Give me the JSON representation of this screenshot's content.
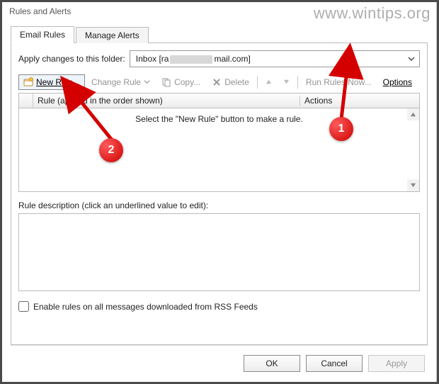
{
  "title": "Rules and Alerts",
  "watermark": "www.wintips.org",
  "tabs": {
    "email_rules": "Email Rules",
    "manage_alerts": "Manage Alerts"
  },
  "apply_changes": {
    "label": "Apply changes to this folder:",
    "value_prefix": "Inbox [ra",
    "value_suffix": "mail.com]"
  },
  "toolbar": {
    "new_rule": "New Rule...",
    "change_rule": "Change Rule",
    "copy": "Copy...",
    "delete": "Delete",
    "run_rules": "Run Rules Now...",
    "options": "Options"
  },
  "list": {
    "col_rule": "Rule (applied in the order shown)",
    "col_actions": "Actions",
    "empty_text": "Select the \"New Rule\" button to make a rule."
  },
  "desc_label": "Rule description (click an underlined value to edit):",
  "rss_check_label": "Enable rules on all messages downloaded from RSS Feeds",
  "buttons": {
    "ok": "OK",
    "cancel": "Cancel",
    "apply": "Apply"
  },
  "annotations": {
    "a1": "1",
    "a2": "2"
  }
}
